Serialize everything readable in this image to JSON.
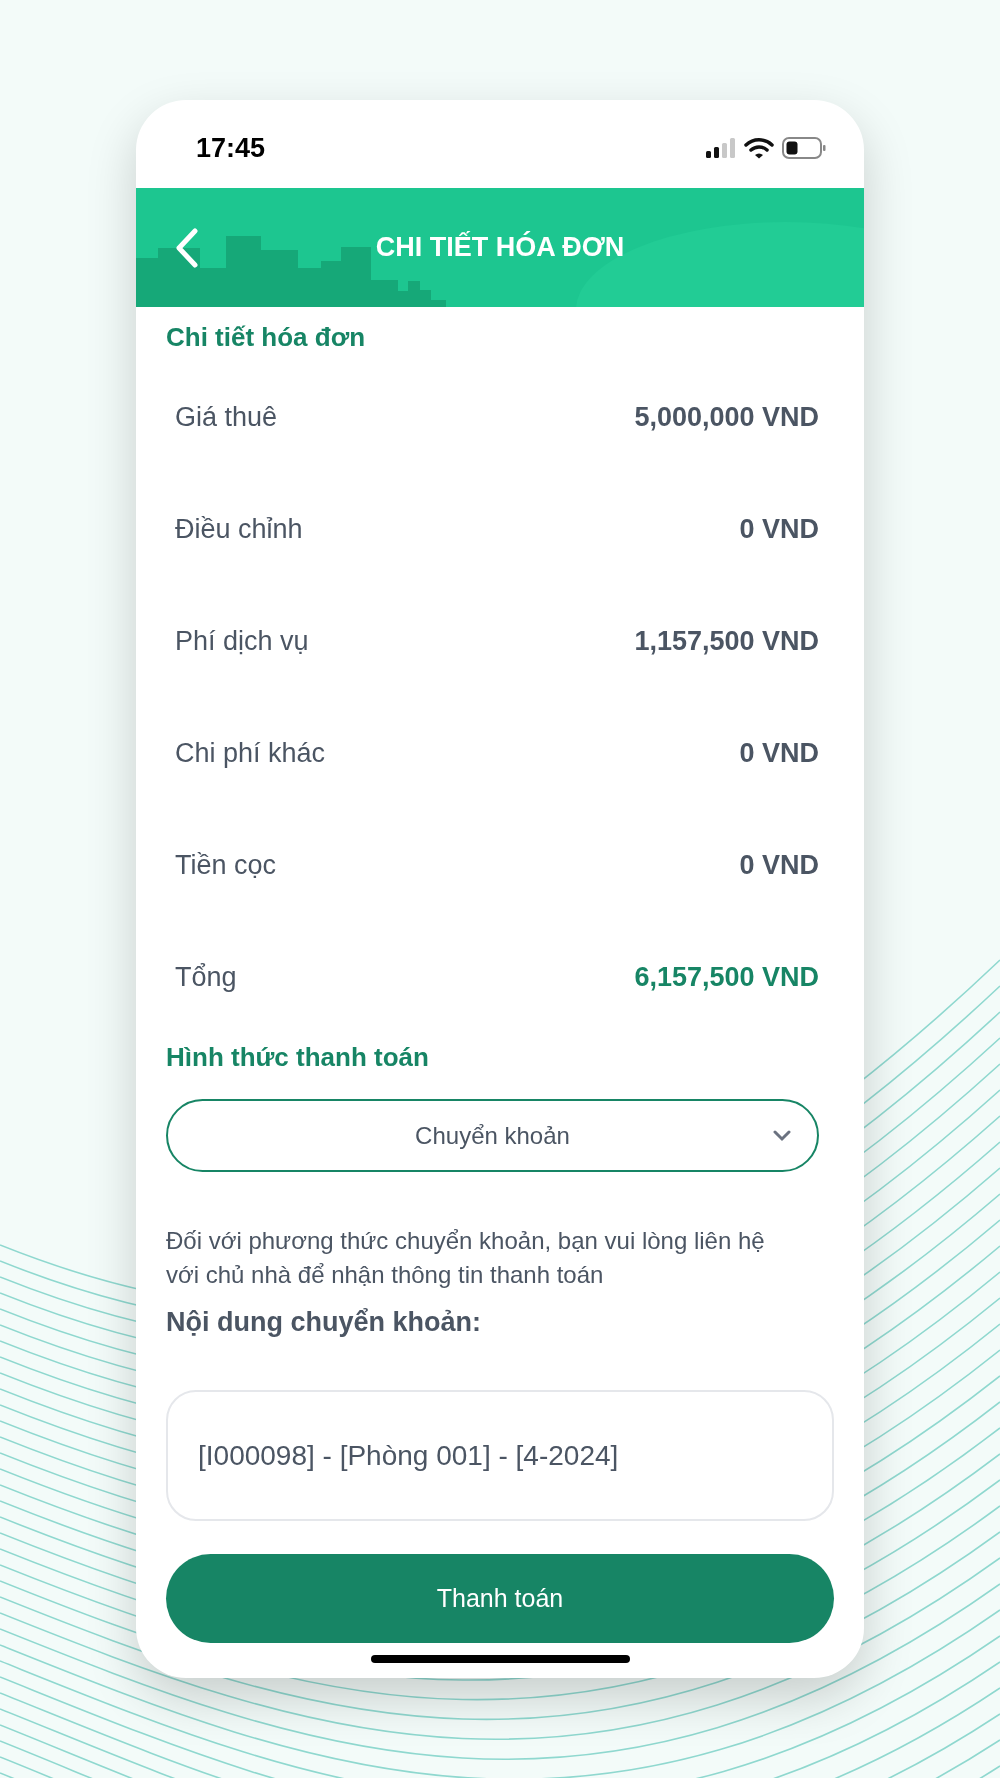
{
  "status_bar": {
    "time": "17:45"
  },
  "header": {
    "title": "CHI TIẾT HÓA ĐƠN"
  },
  "invoice": {
    "title": "Chi tiết hóa đơn",
    "rows": [
      {
        "label": "Giá thuê",
        "value": "5,000,000 VND",
        "kind": "normal"
      },
      {
        "label": "Điều chỉnh",
        "value": "0 VND",
        "kind": "normal"
      },
      {
        "label": "Phí dịch vụ",
        "value": "1,157,500 VND",
        "kind": "normal"
      },
      {
        "label": "Chi phí khác",
        "value": "0 VND",
        "kind": "normal"
      },
      {
        "label": "Tiền cọc",
        "value": "0 VND",
        "kind": "normal"
      },
      {
        "label": "Tổng",
        "value": "6,157,500 VND",
        "kind": "total"
      }
    ]
  },
  "payment": {
    "title": "Hình thức thanh toán",
    "method": "Chuyển khoản",
    "note": "Đối với phương thức chuyển khoản, bạn vui lòng liên hệ với chủ nhà để nhận thông tin thanh toán",
    "transfer_label": "Nội dung chuyển khoản:",
    "transfer_content": "[I000098] - [Phòng 001] - [4-2024]"
  },
  "pay_button": "Thanh toán"
}
